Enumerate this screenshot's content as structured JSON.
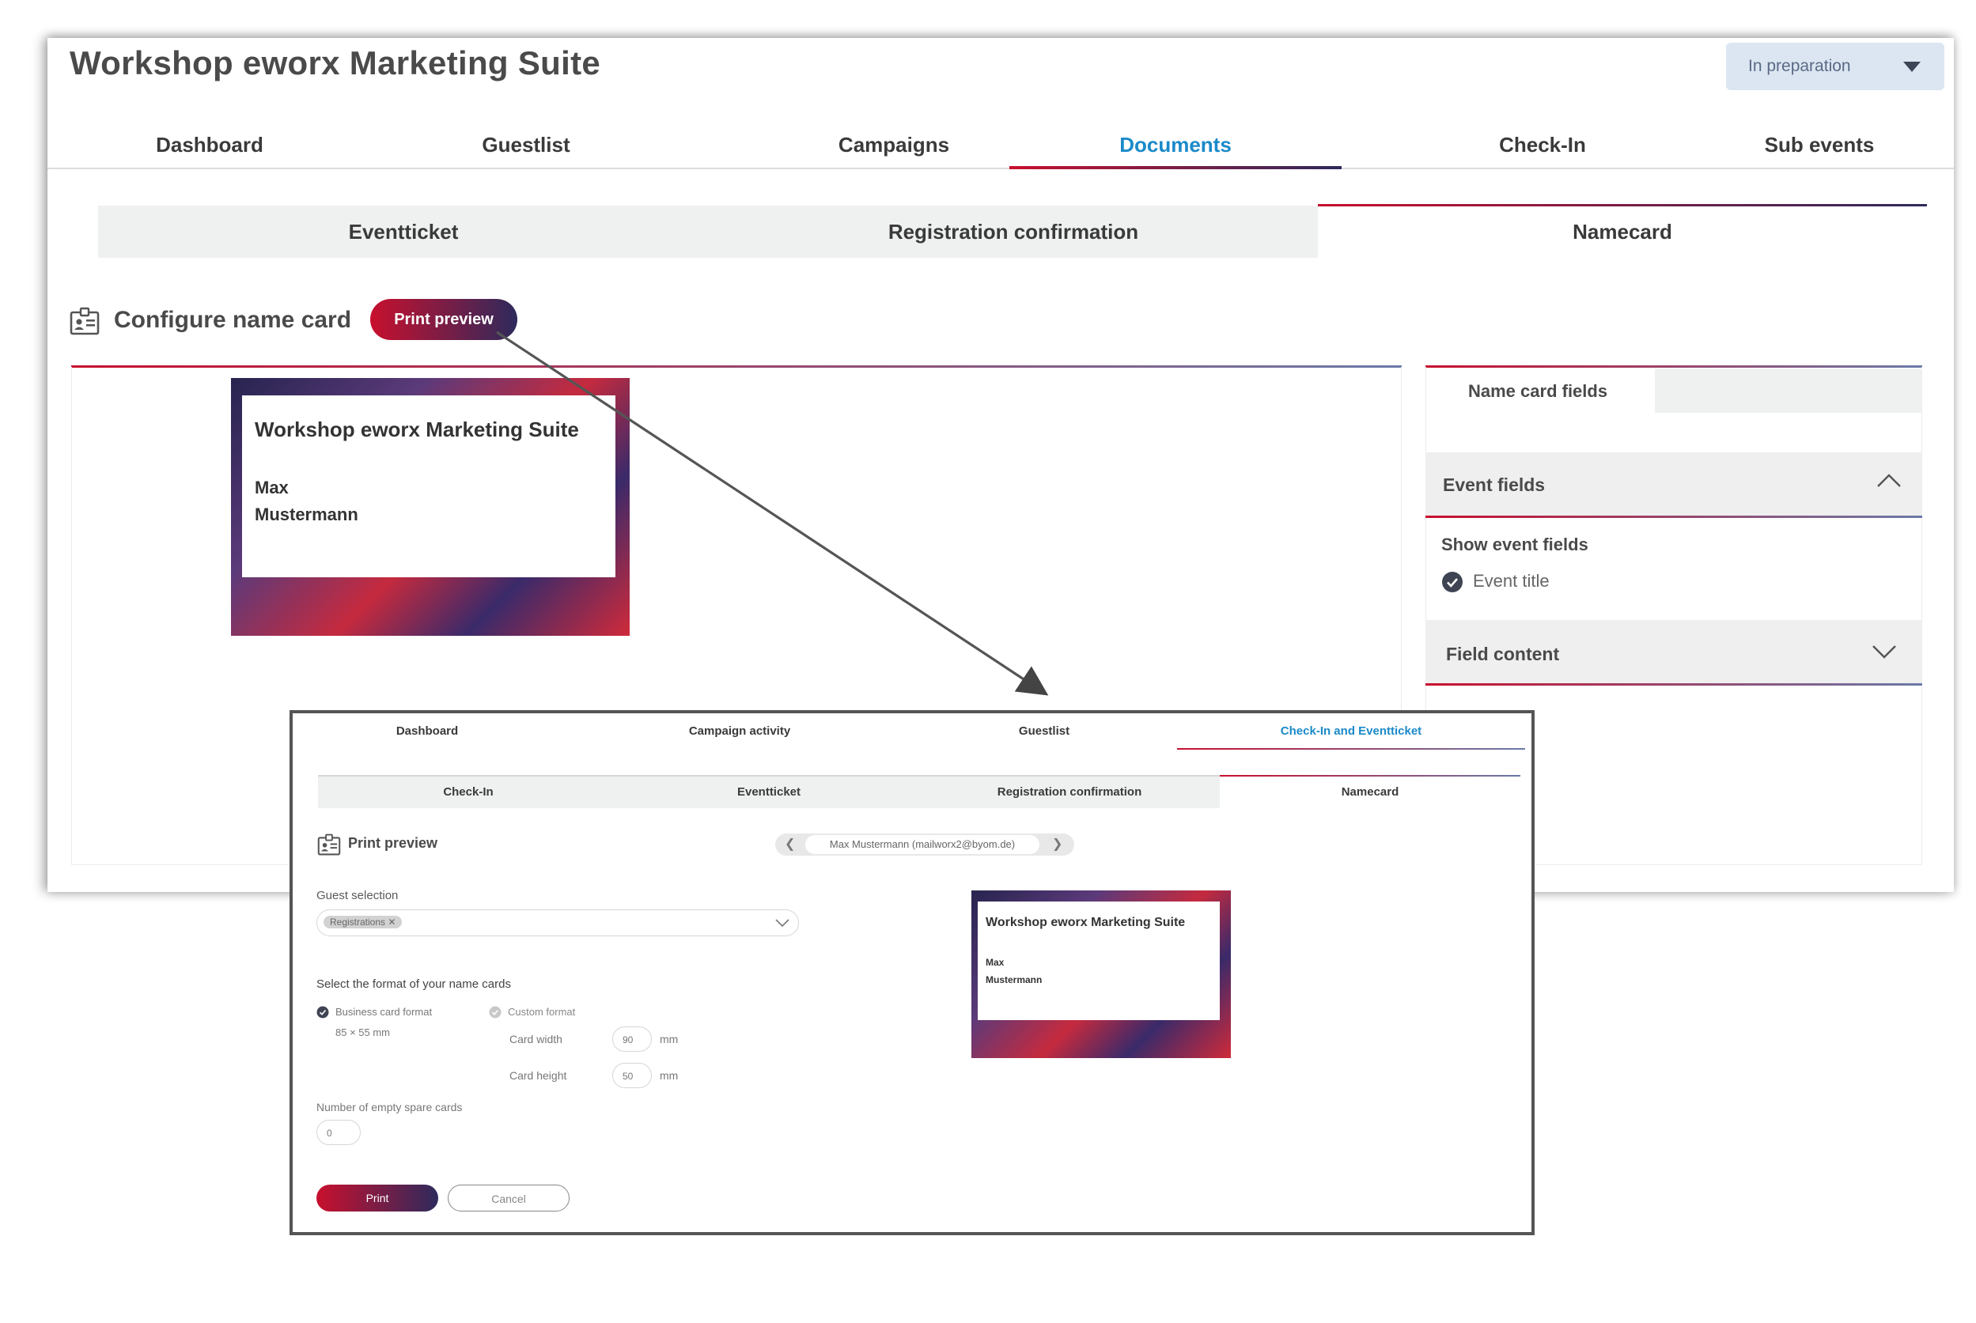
{
  "app": {
    "title": "Workshop eworx Marketing Suite",
    "status": "In preparation"
  },
  "nav": {
    "tabs": [
      "Dashboard",
      "Guestlist",
      "Campaigns",
      "Documents",
      "Check-In",
      "Sub events"
    ],
    "active": "Documents"
  },
  "subtabs": {
    "tabs": [
      "Eventticket",
      "Registration confirmation",
      "Namecard"
    ],
    "active": "Namecard"
  },
  "section": {
    "title": "Configure name card",
    "print_preview_label": "Print preview"
  },
  "namecard": {
    "event_title": "Workshop eworx Marketing Suite",
    "first_name": "Max",
    "last_name": "Mustermann"
  },
  "fields_panel": {
    "tab_label": "Name card fields",
    "event_fields": {
      "title": "Event fields",
      "show_label": "Show event fields",
      "checkbox_label": "Event title",
      "checked": true
    },
    "field_content": {
      "title": "Field content"
    }
  },
  "preview": {
    "tabs": [
      "Dashboard",
      "Campaign activity",
      "Guestlist",
      "Check-In and Eventticket"
    ],
    "active_tab": "Check-In and Eventticket",
    "subtabs": [
      "Check-In",
      "Eventticket",
      "Registration confirmation",
      "Namecard"
    ],
    "active_subtab": "Namecard",
    "title": "Print preview",
    "guest_pager": "Max Mustermann (mailworx2@byom.de)",
    "guest_selection_label": "Guest selection",
    "guest_selection_chip": "Registrations",
    "format_label": "Select the format of your name cards",
    "format_business": "Business card format",
    "format_business_size": "85 × 55 mm",
    "format_custom": "Custom format",
    "card_width_label": "Card width",
    "card_width_value": "90",
    "card_height_label": "Card height",
    "card_height_value": "50",
    "unit": "mm",
    "spare_cards_label": "Number of empty spare cards",
    "spare_cards_value": "0",
    "print_label": "Print",
    "cancel_label": "Cancel",
    "card": {
      "event_title": "Workshop eworx Marketing Suite",
      "first_name": "Max",
      "last_name": "Mustermann"
    }
  },
  "colors": {
    "accent_red": "#c8102e",
    "accent_navy": "#2e2a5c",
    "active_tab_blue": "#1b8ac9"
  }
}
